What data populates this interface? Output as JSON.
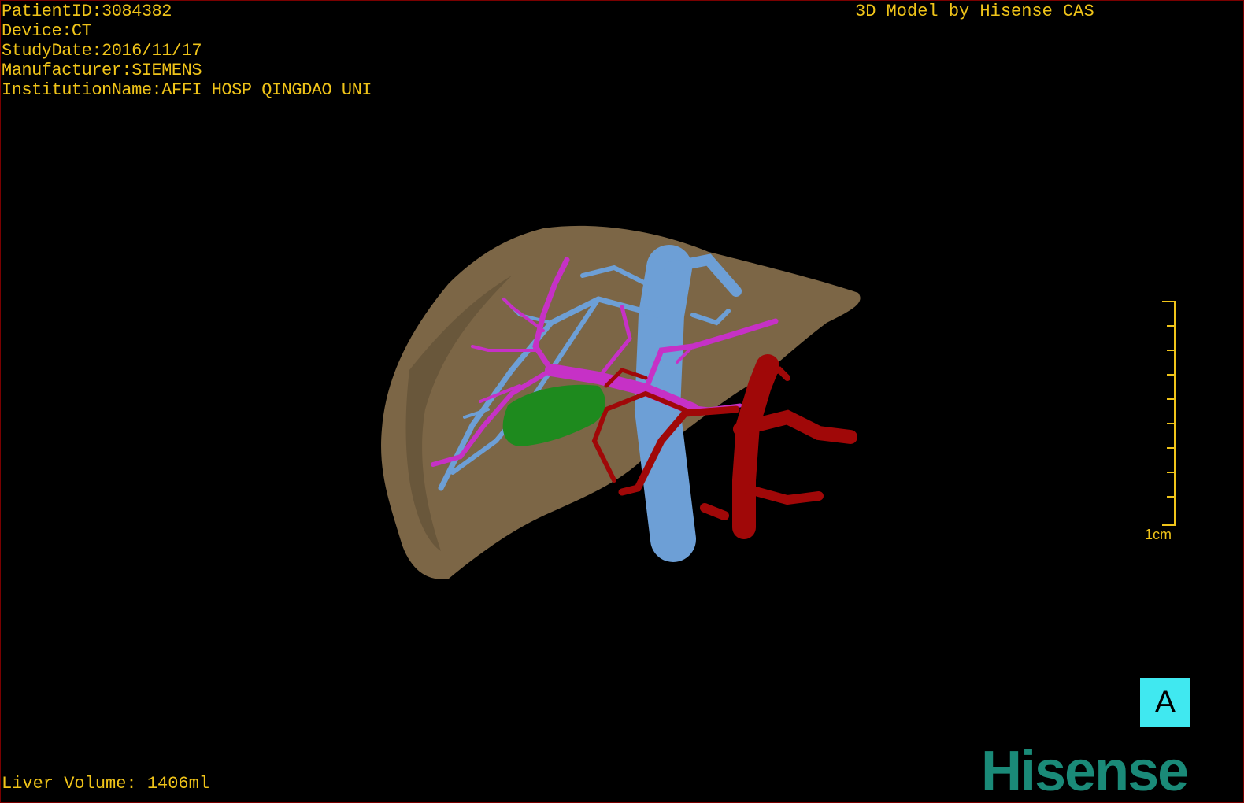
{
  "patient": {
    "id_line": "PatientID:3084382",
    "device_line": "Device:CT",
    "study_date_line": "StudyDate:2016/11/17",
    "manufacturer_line": "Manufacturer:SIEMENS",
    "institution_line": "InstitutionName:AFFI HOSP QINGDAO UNI"
  },
  "credit": "3D Model by Hisense CAS",
  "liver_volume": "Liver Volume: 1406ml",
  "scale_bar": {
    "label": "1cm"
  },
  "orientation_label": "A",
  "logo_text": "Hisense",
  "colors": {
    "overlay_text": "#f0c419",
    "liver": "#7c6646",
    "portal_vein": "#c631c6",
    "hepatic_vein": "#6d9fd6",
    "artery": "#a00808",
    "tumor": "#1e8a1e",
    "orientation_badge": "#40e8f0",
    "logo": "#1a8a78"
  }
}
